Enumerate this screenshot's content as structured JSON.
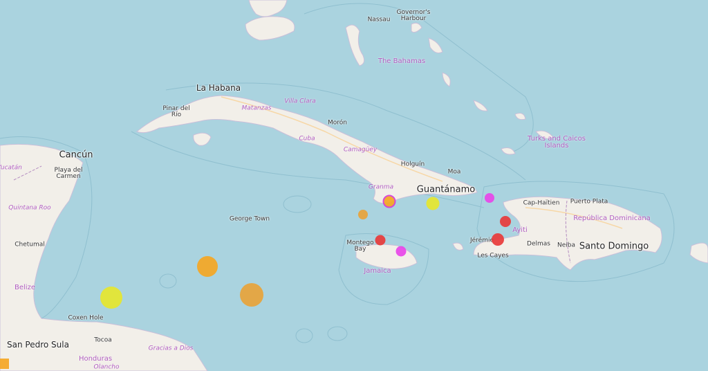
{
  "map": {
    "colors": {
      "water": "#aad3df",
      "land": "#f2efe9",
      "border": "#b48cc0",
      "road": "#f7d7a6"
    },
    "labels": {
      "nassau": "Nassau",
      "governors_harbour": "Governor's\nHarbour",
      "bahamas": "The Bahamas",
      "la_habana": "La Habana",
      "matanzas": "Matanzas",
      "villa_clara": "Villa Clara",
      "pinar_del_rio": "Pinar del\nRío",
      "moron": "Morón",
      "cuba": "Cuba",
      "camaguey": "Camagüey",
      "turks_caicos": "Turks and Caicos\nIslands",
      "cancun": "Cancún",
      "yucatan": "Yucatán",
      "playa_del_carmen": "Playa del\nCarmen",
      "holguin": "Holguín",
      "moa": "Moa",
      "granma": "Granma",
      "guantanamo": "Guantánamo",
      "quintana_roo": "Quintana Roo",
      "cap_haitien": "Cap-Haïtien",
      "puerto_plata": "Puerto Plata",
      "george_town": "George Town",
      "republica_dominicana": "República Dominicana",
      "chetumal": "Chetumal",
      "ayiti": "Ayiti",
      "montego_bay": "Montego\nBay",
      "jeremie": "Jérémie",
      "delmas": "Delmas",
      "neiba": "Neiba",
      "santo_domingo": "Santo Domingo",
      "les_cayes": "Les Cayes",
      "jamaica": "Jamaica",
      "belize": "Belize",
      "coxen_hole": "Coxen Hole",
      "tocoa": "Tocoa",
      "san_pedro_sula": "San Pedro Sula",
      "gracias_a_dios": "Gracias a Dios",
      "honduras": "Honduras",
      "olancho": "Olancho"
    },
    "markers": [
      {
        "id": "granma",
        "color": "#f5a623",
        "stroke": "#d63cd6",
        "size": "medium"
      },
      {
        "id": "guantanamo",
        "color": "#e6e62e",
        "size": "medium"
      },
      {
        "id": "windward",
        "color": "#e845e8",
        "size": "small"
      },
      {
        "id": "cayman-north",
        "color": "#e8a33a",
        "size": "small"
      },
      {
        "id": "haiti-north",
        "color": "#e83a3a",
        "size": "medium"
      },
      {
        "id": "haiti-south",
        "color": "#e83a3a",
        "size": "medium"
      },
      {
        "id": "montego",
        "color": "#e83a3a",
        "size": "small"
      },
      {
        "id": "jamaica-east",
        "color": "#e845e8",
        "size": "small"
      },
      {
        "id": "cayman-west",
        "color": "#f5a623",
        "size": "large"
      },
      {
        "id": "cayman-south",
        "color": "#e8a33a",
        "size": "xlarge"
      },
      {
        "id": "honduras-coast",
        "color": "#e6e62e",
        "size": "large"
      },
      {
        "id": "corner-square",
        "color": "#f5a623",
        "size": "small"
      }
    ]
  }
}
